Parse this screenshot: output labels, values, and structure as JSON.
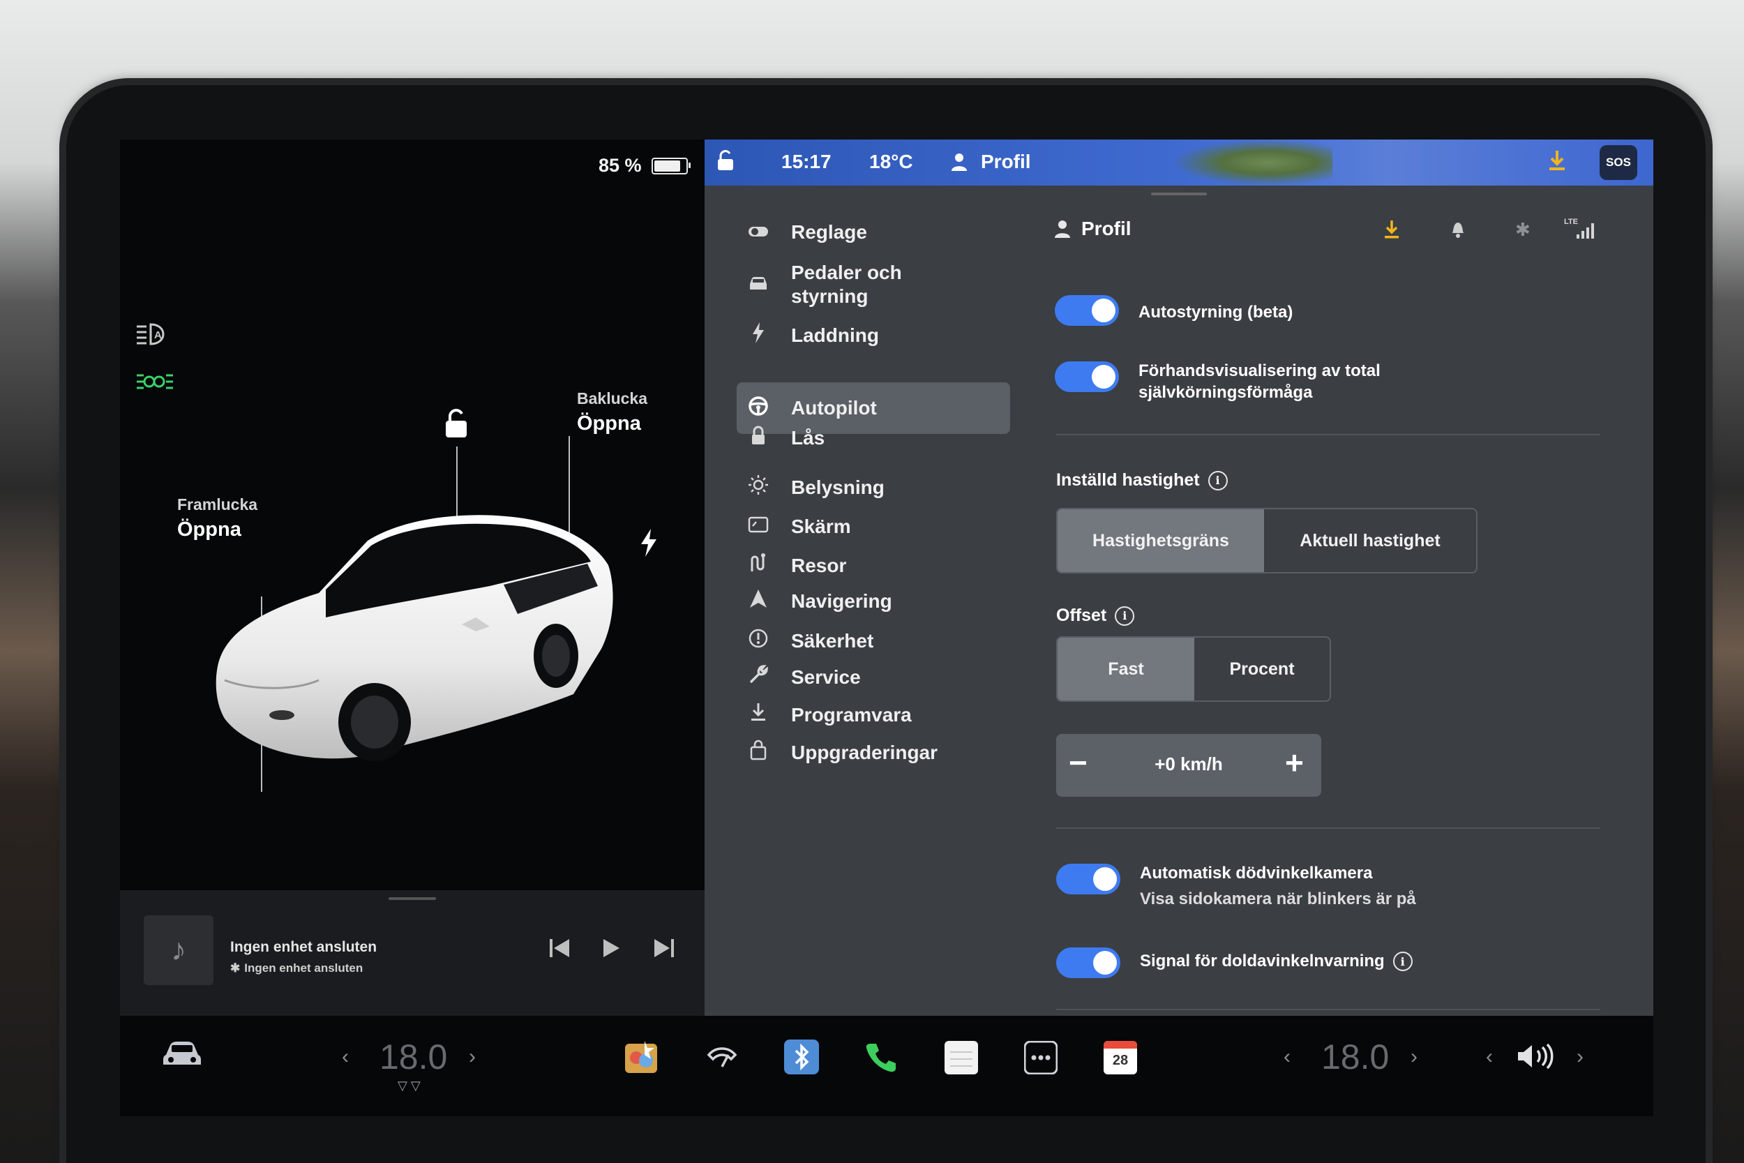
{
  "status": {
    "battery_percent_label": "85 %",
    "battery_level": 0.85,
    "time": "15:17",
    "temperature": "18°C",
    "profile_label": "Profil",
    "sos_label": "SOS"
  },
  "car": {
    "front_trunk_label": "Framlucka",
    "front_trunk_action": "Öppna",
    "rear_trunk_label": "Baklucka",
    "rear_trunk_action": "Öppna"
  },
  "music": {
    "title": "Ingen enhet ansluten",
    "subtitle": "Ingen enhet ansluten"
  },
  "menu": {
    "items": [
      {
        "icon": "toggle-icon",
        "label": "Reglage"
      },
      {
        "icon": "car-icon",
        "label": "Pedaler och\nstyrning"
      },
      {
        "icon": "bolt-icon",
        "label": "Laddning"
      },
      {
        "icon": "steering-wheel-icon",
        "label": "Autopilot"
      },
      {
        "icon": "lock-icon",
        "label": "Lås"
      },
      {
        "icon": "sun-icon",
        "label": "Belysning"
      },
      {
        "icon": "display-icon",
        "label": "Skärm"
      },
      {
        "icon": "route-icon",
        "label": "Resor"
      },
      {
        "icon": "navigation-icon",
        "label": "Navigering"
      },
      {
        "icon": "alert-icon",
        "label": "Säkerhet"
      },
      {
        "icon": "wrench-icon",
        "label": "Service"
      },
      {
        "icon": "download-icon",
        "label": "Programvara"
      },
      {
        "icon": "bag-icon",
        "label": "Uppgraderingar"
      }
    ],
    "active_index": 3
  },
  "panel": {
    "profile_title": "Profil",
    "autosteer_label": "Autostyrning (beta)",
    "fsd_preview_line1": "Förhandsvisualisering av total",
    "fsd_preview_line2": "självkörningsförmåga",
    "set_speed_label": "Inställd hastighet",
    "speed_options": [
      "Hastighetsgräns",
      "Aktuell hastighet"
    ],
    "speed_selected": "Hastighetsgräns",
    "offset_label": "Offset",
    "offset_options": [
      "Fast",
      "Procent"
    ],
    "offset_selected": "Fast",
    "offset_value": "+0 km/h",
    "blindspot_camera_label": "Automatisk dödvinkelkamera",
    "blindspot_camera_sub": "Visa sidokamera när blinkers är på",
    "blindspot_chime_label": "Signal för doldavinkelnvarning",
    "toggles": {
      "autosteer": true,
      "fsd_preview": true,
      "blindspot_camera": true,
      "blindspot_chime": true
    }
  },
  "dock": {
    "driver_temp": "18.0",
    "passenger_temp": "18.0",
    "calendar_day": "28"
  }
}
